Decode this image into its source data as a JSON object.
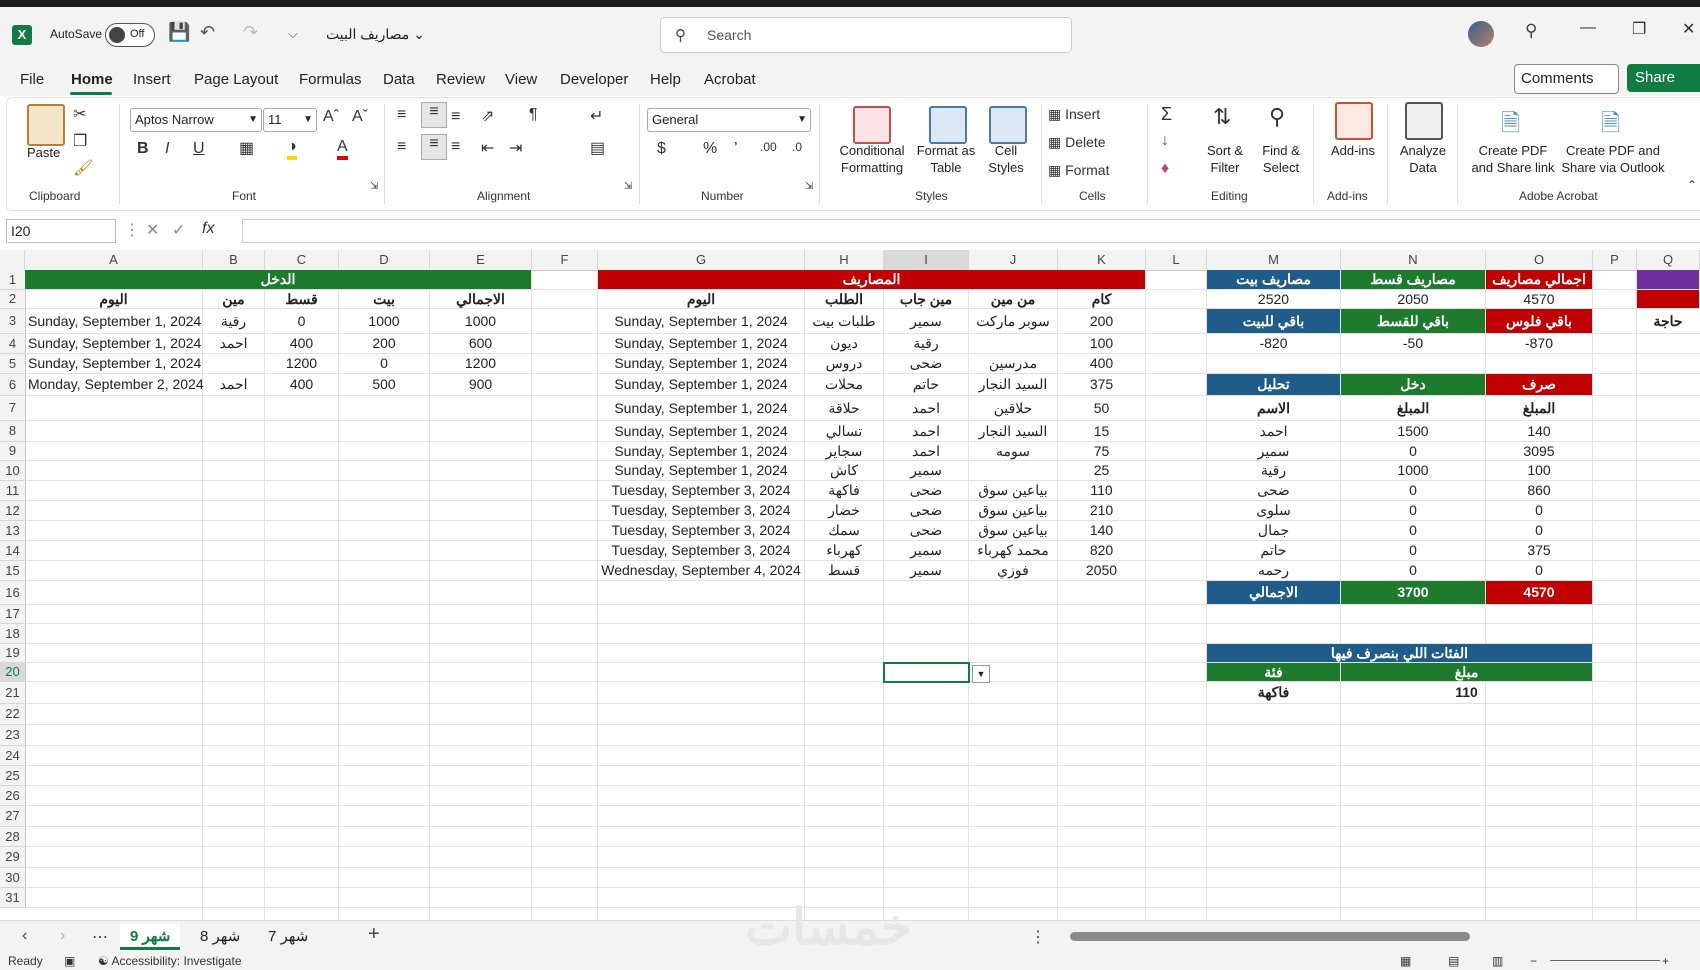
{
  "titlebar": {
    "app_icon": "excel-logo",
    "autosave_label": "AutoSave",
    "autosave_state": "Off",
    "document_title": "مصاريف البيت",
    "search_placeholder": "Search"
  },
  "menu": {
    "items": [
      "File",
      "Home",
      "Insert",
      "Page Layout",
      "Formulas",
      "Data",
      "Review",
      "View",
      "Developer",
      "Help",
      "Acrobat"
    ],
    "active": "Home",
    "comments_label": "Comments",
    "share_label": "Share"
  },
  "ribbon": {
    "clipboard": {
      "paste": "Paste",
      "label": "Clipboard"
    },
    "font": {
      "name": "Aptos Narrow",
      "size": "11",
      "label": "Font",
      "bold": "B",
      "italic": "I",
      "underline": "U"
    },
    "alignment": {
      "label": "Alignment"
    },
    "number": {
      "format": "General",
      "label": "Number"
    },
    "styles": {
      "conditional": "Conditional",
      "conditional2": "Formatting",
      "format_table": "Format as",
      "format_table2": "Table",
      "cell_styles": "Cell",
      "cell_styles2": "Styles",
      "label": "Styles"
    },
    "cells": {
      "insert": "Insert",
      "delete": "Delete",
      "format": "Format",
      "label": "Cells"
    },
    "editing": {
      "sort": "Sort &",
      "sort2": "Filter",
      "find": "Find &",
      "find2": "Select",
      "label": "Editing"
    },
    "addins": {
      "addins": "Add-ins",
      "label": "Add-ins"
    },
    "analyze": {
      "l1": "Analyze",
      "l2": "Data"
    },
    "acrobat": {
      "c1": "Create PDF",
      "c2": "and Share link",
      "d1": "Create PDF and",
      "d2": "Share via Outlook",
      "label": "Adobe Acrobat"
    }
  },
  "formula_bar": {
    "name_box": "I20",
    "fx": "fx",
    "content": ""
  },
  "columns": [
    "A",
    "B",
    "C",
    "D",
    "E",
    "F",
    "G",
    "H",
    "I",
    "J",
    "K",
    "L",
    "M",
    "N",
    "O",
    "P",
    "Q"
  ],
  "selected_column": "I",
  "rows": [
    "1",
    "2",
    "3",
    "4",
    "5",
    "6",
    "7",
    "8",
    "9",
    "10",
    "11",
    "12",
    "13",
    "14",
    "15",
    "16",
    "17",
    "18",
    "19",
    "20",
    "21",
    "22",
    "23",
    "24",
    "25",
    "26",
    "27",
    "28",
    "29",
    "30",
    "31"
  ],
  "selected_row": "20",
  "income": {
    "title": "الدخل",
    "headers": {
      "day": "اليوم",
      "who": "مين",
      "installment": "قسط",
      "house": "بيت",
      "total": "الاجمالي"
    },
    "rows": [
      {
        "day": "Sunday, September 1, 2024",
        "who": "رقية",
        "installment": "0",
        "house": "1000",
        "total": "1000"
      },
      {
        "day": "Sunday, September 1, 2024",
        "who": "احمد",
        "installment": "400",
        "house": "200",
        "total": "600"
      },
      {
        "day": "Sunday, September 1, 2024",
        "who": "",
        "installment": "1200",
        "house": "0",
        "total": "1200"
      },
      {
        "day": "Monday, September 2, 2024",
        "who": "احمد",
        "installment": "400",
        "house": "500",
        "total": "900"
      }
    ]
  },
  "expenses": {
    "title": "المصاريف",
    "headers": {
      "day": "اليوم",
      "item": "الطلب",
      "brought_by": "مين جاب",
      "from": "من مين",
      "amount": "كام"
    },
    "rows": [
      {
        "day": "Sunday, September 1, 2024",
        "item": "طلبات بيت",
        "brought_by": "سمير",
        "from": "سوبر ماركت",
        "amount": "200"
      },
      {
        "day": "Sunday, September 1, 2024",
        "item": "ديون",
        "brought_by": "رقية",
        "from": "",
        "amount": "100"
      },
      {
        "day": "Sunday, September 1, 2024",
        "item": "دروس",
        "brought_by": "ضحى",
        "from": "مدرسين",
        "amount": "400"
      },
      {
        "day": "Sunday, September 1, 2024",
        "item": "محلات",
        "brought_by": "حاتم",
        "from": "السيد النجار",
        "amount": "375"
      },
      {
        "day": "Sunday, September 1, 2024",
        "item": "حلاقة",
        "brought_by": "احمد",
        "from": "حلاقين",
        "amount": "50"
      },
      {
        "day": "Sunday, September 1, 2024",
        "item": "تسالي",
        "brought_by": "احمد",
        "from": "السيد النجار",
        "amount": "15"
      },
      {
        "day": "Sunday, September 1, 2024",
        "item": "سجاير",
        "brought_by": "احمد",
        "from": "سومه",
        "amount": "75"
      },
      {
        "day": "Sunday, September 1, 2024",
        "item": "كاش",
        "brought_by": "سمير",
        "from": "",
        "amount": "25"
      },
      {
        "day": "Tuesday, September 3, 2024",
        "item": "فاكهة",
        "brought_by": "ضحى",
        "from": "بياعين سوق",
        "amount": "110"
      },
      {
        "day": "Tuesday, September 3, 2024",
        "item": "خضار",
        "brought_by": "ضحى",
        "from": "بياعين سوق",
        "amount": "210"
      },
      {
        "day": "Tuesday, September 3, 2024",
        "item": "سمك",
        "brought_by": "ضحى",
        "from": "بياعين سوق",
        "amount": "140"
      },
      {
        "day": "Tuesday, September 3, 2024",
        "item": "كهرباء",
        "brought_by": "سمير",
        "from": "محمد كهرباء",
        "amount": "820"
      },
      {
        "day": "Wednesday, September 4, 2024",
        "item": "قسط",
        "brought_by": "سمير",
        "from": "فوزي",
        "amount": "2050"
      }
    ]
  },
  "summary": {
    "house_exp_label": "مصاريف بيت",
    "inst_exp_label": "مصاريف قسط",
    "total_exp_label": "اجمالي مصاريف",
    "house_exp": "2520",
    "inst_exp": "2050",
    "total_exp": "4570",
    "rem_house_label": "باقي للبيت",
    "rem_inst_label": "باقي للقسط",
    "rem_money_label": "باقي فلوس",
    "rem_house": "-820",
    "rem_inst": "-50",
    "rem_money": "-870",
    "q3_label": "حاجة"
  },
  "analysis": {
    "title_analysis": "تحليل",
    "title_income": "دخل",
    "title_spend": "صرف",
    "name_header": "الاسم",
    "amount_header": "المبلغ",
    "amount_header2": "المبلغ",
    "rows": [
      {
        "name": "احمد",
        "income": "1500",
        "spend": "140"
      },
      {
        "name": "سمير",
        "income": "0",
        "spend": "3095"
      },
      {
        "name": "رقية",
        "income": "1000",
        "spend": "100"
      },
      {
        "name": "ضحى",
        "income": "0",
        "spend": "860"
      },
      {
        "name": "سلوى",
        "income": "0",
        "spend": "0"
      },
      {
        "name": "جمال",
        "income": "0",
        "spend": "0"
      },
      {
        "name": "حاتم",
        "income": "0",
        "spend": "375"
      },
      {
        "name": "رحمه",
        "income": "0",
        "spend": "0"
      }
    ],
    "total_label": "الاجمالي",
    "total_income": "3700",
    "total_spend": "4570"
  },
  "categories": {
    "title": "الفئات اللي بنصرف فيها",
    "cat_header": "فئة",
    "amount_header": "مبلغ",
    "cat_value": "فاكهة",
    "amount_value": "110"
  },
  "sheet_tabs": [
    "شهر 9",
    "شهر 8",
    "شهر 7"
  ],
  "active_tab": "شهر 9",
  "status": {
    "ready": "Ready",
    "accessibility": "Accessibility: Investigate"
  },
  "watermark": "خمسات",
  "colors": {
    "excel_green": "#107c41",
    "header_green": "#1e7b2e",
    "header_red": "#c00000",
    "header_blue": "#1f5c8a",
    "purple": "#7030a0"
  }
}
